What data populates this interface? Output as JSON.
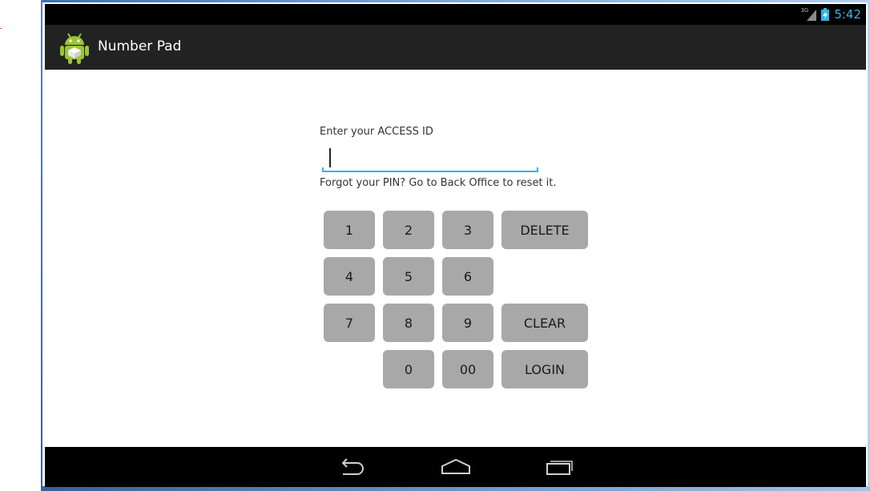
{
  "status_bar": {
    "network_label": "3G",
    "time": "5:42",
    "accent_color": "#33b5e5"
  },
  "action_bar": {
    "title": "Number Pad",
    "icon": "android-robot-icon"
  },
  "form": {
    "prompt": "Enter your ACCESS ID",
    "input_value": "",
    "hint": "Forgot your PIN? Go to Back Office to reset it."
  },
  "keypad": {
    "keys": [
      "1",
      "2",
      "3",
      "DELETE",
      "4",
      "5",
      "6",
      "7",
      "8",
      "9",
      "CLEAR",
      "0",
      "00",
      "LOGIN"
    ],
    "key_color": "#a8a8a8"
  },
  "nav_bar": {
    "icons": [
      "back-icon",
      "home-icon",
      "recent-apps-icon"
    ]
  }
}
